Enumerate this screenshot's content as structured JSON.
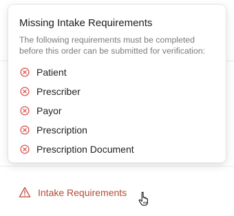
{
  "popover": {
    "title": "Missing Intake Requirements",
    "description": "The following requirements must be completed before this order can be submitted for verification:",
    "items": [
      {
        "label": "Patient",
        "icon": "x-circle-icon"
      },
      {
        "label": "Prescriber",
        "icon": "x-circle-icon"
      },
      {
        "label": "Payor",
        "icon": "x-circle-icon"
      },
      {
        "label": "Prescription",
        "icon": "x-circle-icon"
      },
      {
        "label": "Prescription Document",
        "icon": "x-circle-icon"
      }
    ]
  },
  "trigger": {
    "label": "Intake Requirements",
    "icon": "warning-triangle-icon"
  },
  "colors": {
    "error_red": "#d9534f",
    "warning_text": "#b24a35",
    "title_text": "#1c1c1e",
    "muted_text": "#7b7b80"
  }
}
